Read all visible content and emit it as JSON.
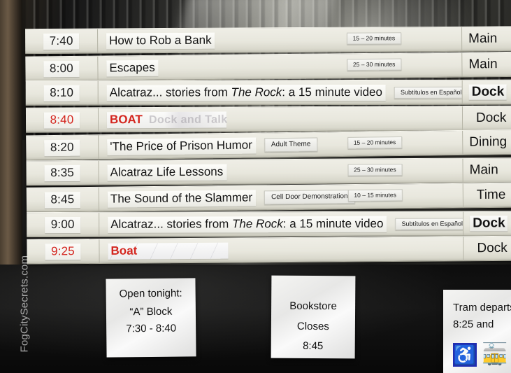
{
  "watermark": "FogCitySecrets.com",
  "board": {
    "rows": [
      {
        "time": "7:40",
        "title": "How to Rob a Bank",
        "title_italic": "",
        "title_tail": "",
        "note": "",
        "duration": "15 – 20 minutes",
        "room": "Main",
        "is_boat": false,
        "ghost": ""
      },
      {
        "time": "8:00",
        "title": "Escapes",
        "title_italic": "",
        "title_tail": "",
        "note": "",
        "duration": "25 – 30 minutes",
        "room": "Main",
        "is_boat": false,
        "ghost": ""
      },
      {
        "time": "8:10",
        "title": "Alcatraz... stories from ",
        "title_italic": "The Rock",
        "title_tail": ": a 15 minute video",
        "note": "Subtítulos en Español",
        "duration": "",
        "room": "Dock",
        "is_boat": false,
        "ghost": ""
      },
      {
        "time": "8:40",
        "title": "BOAT",
        "title_italic": "",
        "title_tail": "",
        "note": "",
        "duration": "",
        "room": "Dock",
        "is_boat": true,
        "ghost": "Dock and Talk"
      },
      {
        "time": "8:20",
        "title": "'The Price of Prison Humor",
        "title_italic": "",
        "title_tail": "",
        "note": "Adult Theme",
        "duration": "15 – 20 minutes",
        "room": "Dining",
        "is_boat": false,
        "ghost": ""
      },
      {
        "time": "8:35",
        "title": "Alcatraz Life Lessons",
        "title_italic": "",
        "title_tail": "",
        "note": "",
        "duration": "25 – 30 minutes",
        "room": "Main",
        "is_boat": false,
        "ghost": ""
      },
      {
        "time": "8:45",
        "title": "The Sound of the Slammer",
        "title_italic": "",
        "title_tail": "",
        "note": "Cell Door Demonstration",
        "duration": "10 – 15 minutes",
        "room": "Time",
        "is_boat": false,
        "ghost": ""
      },
      {
        "time": "9:00",
        "title": "Alcatraz... stories from ",
        "title_italic": "The Rock",
        "title_tail": ": a 15 minute video",
        "note": "Subtítulos en Español",
        "duration": "",
        "room": "Dock",
        "is_boat": false,
        "ghost": ""
      },
      {
        "time": "9:25",
        "title": "Boat",
        "title_italic": "",
        "title_tail": "",
        "note": "",
        "duration": "",
        "room": "Dock",
        "is_boat": true,
        "ghost": ""
      }
    ]
  },
  "signs": {
    "a_block": {
      "line1": "Open tonight:",
      "line2": "“A” Block",
      "line3": "7:30 - 8:40"
    },
    "bookstore": {
      "line1": "Bookstore",
      "line2": "Closes",
      "line3": "8:45"
    },
    "tram": {
      "line1": "Tram departs",
      "line2": "8:25 and",
      "wheelchair_icon": "♿",
      "tram_icon": "🚋"
    }
  },
  "colors": {
    "boat_red": "#d4261f",
    "board_cream": "#e8e7dd",
    "accessible_blue": "#1f2db0"
  }
}
